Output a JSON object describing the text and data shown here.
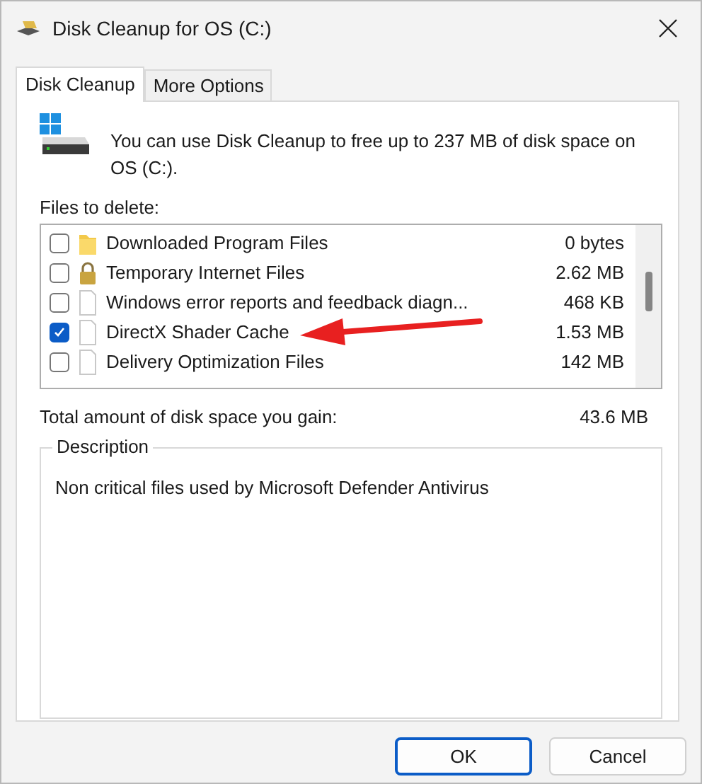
{
  "window": {
    "title": "Disk Cleanup for OS (C:)"
  },
  "tabs": [
    {
      "label": "Disk Cleanup",
      "selected": true
    },
    {
      "label": "More Options",
      "selected": false
    }
  ],
  "intro": "You can use Disk Cleanup to free up to 237 MB of disk space on OS (C:).",
  "files_label": "Files to delete:",
  "files": [
    {
      "name": "Downloaded Program Files",
      "size": "0 bytes",
      "kind": "folder",
      "checked": false,
      "selected": false
    },
    {
      "name": "Temporary Internet Files",
      "size": "2.62 MB",
      "kind": "lock",
      "checked": false,
      "selected": false
    },
    {
      "name": "Windows error reports and feedback diagn...",
      "size": "468 KB",
      "kind": "file",
      "checked": false,
      "selected": false
    },
    {
      "name": "DirectX Shader Cache",
      "size": "1.53 MB",
      "kind": "file",
      "checked": true,
      "selected": false
    },
    {
      "name": "Delivery Optimization Files",
      "size": "142 MB",
      "kind": "file",
      "checked": false,
      "selected": false
    }
  ],
  "total": {
    "label": "Total amount of disk space you gain:",
    "value": "43.6 MB"
  },
  "description": {
    "title": "Description",
    "text": "Non critical files used by Microsoft Defender Antivirus"
  },
  "buttons": [
    "OK",
    "Cancel"
  ]
}
